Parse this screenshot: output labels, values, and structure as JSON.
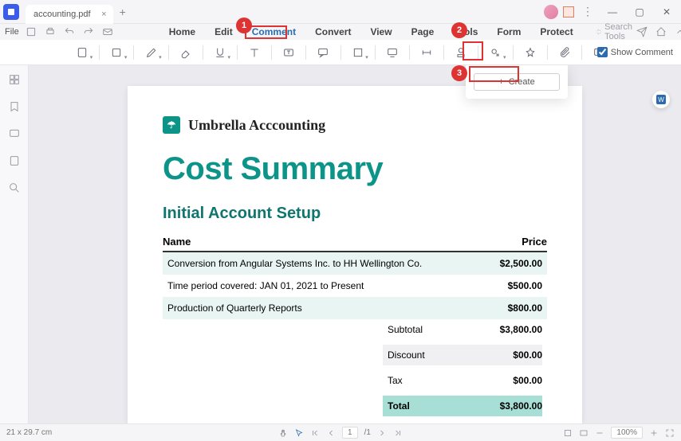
{
  "tab_title": "accounting.pdf",
  "file_label": "File",
  "menu": {
    "home": "Home",
    "edit": "Edit",
    "comment": "Comment",
    "convert": "Convert",
    "view": "View",
    "page": "Page",
    "tools": "Tools",
    "form": "Form",
    "protect": "Protect"
  },
  "search_placeholder": "Search Tools",
  "show_comment_label": "Show Comment",
  "popup": {
    "create": "Create"
  },
  "callouts": {
    "c1": "1",
    "c2": "2",
    "c3": "3"
  },
  "doc": {
    "brand": "Umbrella Acccounting",
    "title": "Cost Summary",
    "section": "Initial Account Setup",
    "headers": {
      "name": "Name",
      "price": "Price"
    },
    "rows": [
      {
        "name": "Conversion from Angular Systems Inc. to HH Wellington Co.",
        "price": "$2,500.00"
      },
      {
        "name": "Time period covered: JAN 01, 2021 to Present",
        "price": "$500.00"
      },
      {
        "name": "Production of Quarterly Reports",
        "price": "$800.00"
      }
    ],
    "summary": {
      "subtotal_label": "Subtotal",
      "subtotal": "$3,800.00",
      "discount_label": "Discount",
      "discount": "$00.00",
      "tax_label": "Tax",
      "tax": "$00.00",
      "total_label": "Total",
      "total": "$3,800.00"
    }
  },
  "status": {
    "dimensions": "21 x 29.7 cm",
    "page_current": "1",
    "page_sep": "/1",
    "zoom": "100%"
  }
}
